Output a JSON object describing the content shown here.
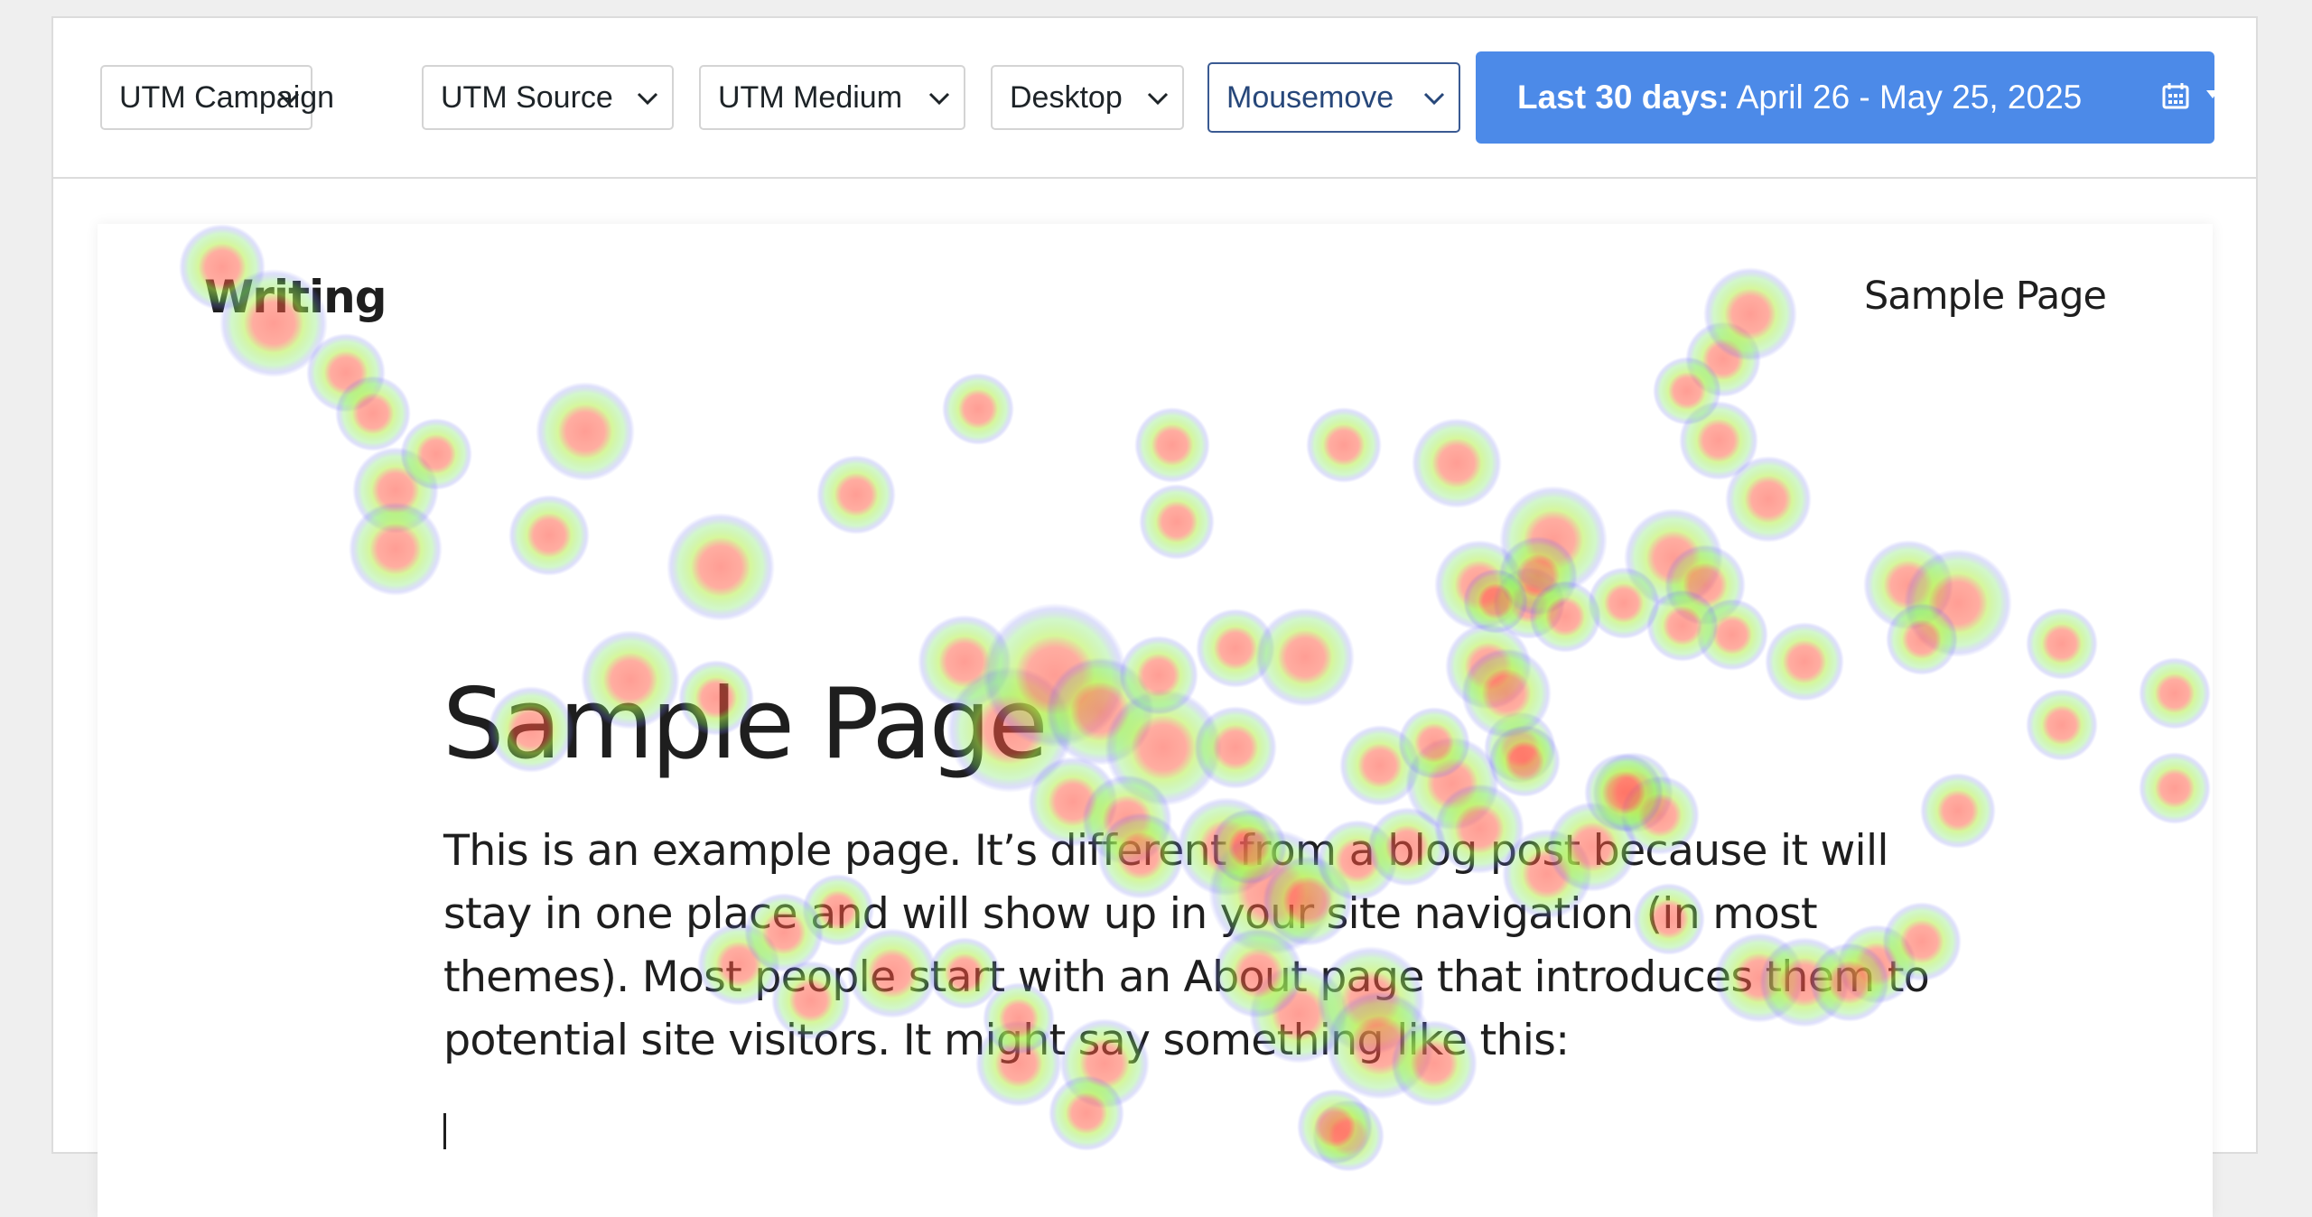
{
  "filters": {
    "utm_campaign": "UTM Campaign",
    "utm_source": "UTM Source",
    "utm_medium": "UTM Medium",
    "device": "Desktop",
    "mode": "Mousemove"
  },
  "date_range": {
    "label": "Last 30 days:",
    "range": "April 26 - May 25, 2025",
    "icon": "calendar-icon"
  },
  "site": {
    "title": "Writing",
    "nav_item": "Sample Page"
  },
  "page": {
    "title": "Sample Page",
    "body": "This is an example page. It’s different from a blog post because it will stay in one place and will show up in your site navigation (in most themes). Most people start with an About page that introduces them to potential site visitors. It might say something like this:"
  },
  "colors": {
    "accent": "#4c8ae8",
    "active_border": "#3a5a92"
  }
}
